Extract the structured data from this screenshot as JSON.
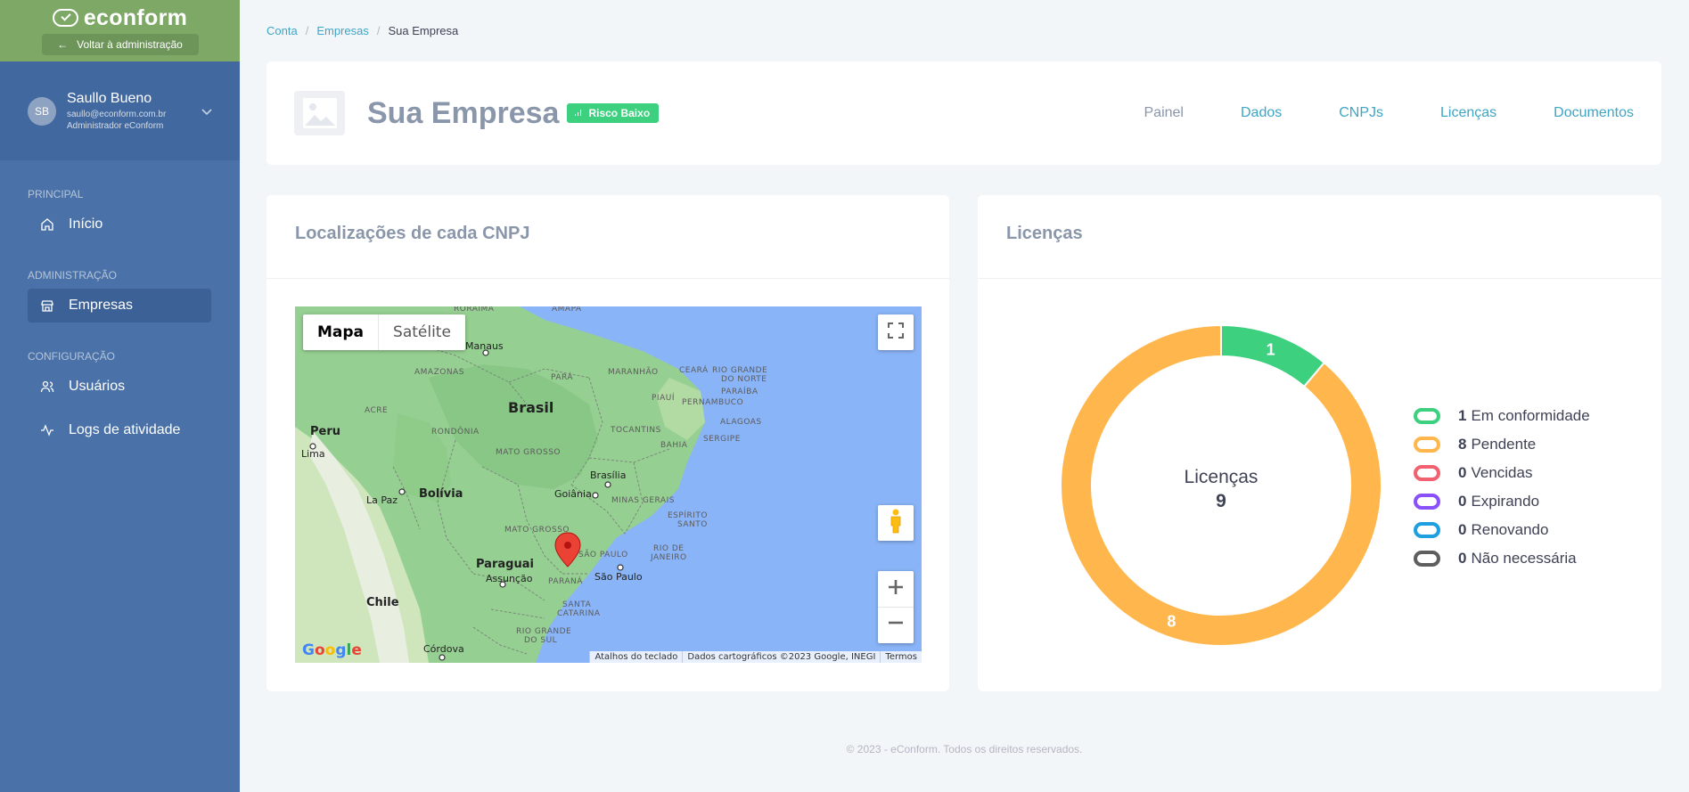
{
  "brand": {
    "name": "econform",
    "back_label": "Voltar à administração"
  },
  "user": {
    "initials": "SB",
    "name": "Saullo Bueno",
    "email": "saullo@econform.com.br",
    "role": "Administrador eConform"
  },
  "nav": {
    "sections": [
      {
        "title": "PRINCIPAL",
        "items": [
          {
            "label": "Início",
            "icon": "home-icon"
          }
        ]
      },
      {
        "title": "ADMINISTRAÇÃO",
        "items": [
          {
            "label": "Empresas",
            "icon": "store-icon",
            "active": true
          }
        ]
      },
      {
        "title": "CONFIGURAÇÃO",
        "items": [
          {
            "label": "Usuários",
            "icon": "users-icon"
          },
          {
            "label": "Logs de atividade",
            "icon": "activity-icon"
          }
        ]
      }
    ]
  },
  "breadcrumb": [
    "Conta",
    "Empresas",
    "Sua Empresa"
  ],
  "company": {
    "name": "Sua Empresa",
    "risk": "Risco Baixo"
  },
  "tabs": [
    "Painel",
    "Dados",
    "CNPJs",
    "Licenças",
    "Documentos"
  ],
  "map_card": {
    "title": "Localizações de cada CNPJ",
    "map_type": {
      "map": "Mapa",
      "satellite": "Satélite"
    },
    "labels": {
      "amapa": "AMAPÁ",
      "roraima": "RORAIMA",
      "manaus": "Manaus",
      "amazonas": "AMAZONAS",
      "para": "PARÁ",
      "maranhao": "MARANHÃO",
      "ceara": "CEARÁ",
      "rio_grande_do_norte_1": "RIO GRANDE",
      "rio_grande_do_norte_2": "DO NORTE",
      "paraiba": "PARAÍBA",
      "piaui": "PIAUÍ",
      "pernambuco": "PERNAMBUCO",
      "alagoas": "ALAGOAS",
      "sergipe": "SERGIPE",
      "acre": "ACRE",
      "brasil": "Brasil",
      "rondonia": "RONDÔNIA",
      "tocantins": "TOCANTINS",
      "bahia": "BAHIA",
      "peru": "Peru",
      "lima": "Lima",
      "mato_grosso": "MATO GROSSO",
      "brasilia": "Brasília",
      "la_paz": "La Paz",
      "bolivia": "Bolívia",
      "goiania": "Goiânia",
      "minas_gerais": "MINAS GERAIS",
      "espirito_santo_1": "ESPÍRITO",
      "espirito_santo_2": "SANTO",
      "mato_grosso_sul": "MATO GROSSO",
      "sao_paulo_state": "SÃO PAULO",
      "rio_de_janeiro_1": "RIO DE",
      "rio_de_janeiro_2": "JANEIRO",
      "paraguai": "Paraguai",
      "assuncao": "Assunção",
      "parana": "PARANÁ",
      "sao_paulo": "São Paulo",
      "chile": "Chile",
      "santa_catarina_1": "SANTA",
      "santa_catarina_2": "CATARINA",
      "rio_grande_do_sul_1": "RIO GRANDE",
      "rio_grande_do_sul_2": "DO SUL",
      "cordova": "Córdova"
    },
    "google": "Google",
    "attribution": [
      "Atalhos do teclado",
      "Dados cartográficos ©2023 Google, INEGI",
      "Termos"
    ],
    "colors": {
      "water": "#8ab4f8",
      "land": "#96cf92",
      "dry_land": "#cfe6bd",
      "andes": "#e8eee0",
      "border": "#7a8a7a",
      "pin": "#ea4335"
    }
  },
  "licenses_card": {
    "title": "Licenças",
    "center_label": "Licenças",
    "center_total": "9"
  },
  "chart_data": {
    "type": "pie",
    "donut": true,
    "title": "",
    "center_label": "Licenças",
    "center_value": 9,
    "legend_position": "right",
    "series": [
      {
        "name": "Em conformidade",
        "value": 1,
        "color": "#3dd07f"
      },
      {
        "name": "Pendente",
        "value": 8,
        "color": "#ffb74d"
      },
      {
        "name": "Vencidas",
        "value": 0,
        "color": "#f1616f"
      },
      {
        "name": "Expirando",
        "value": 0,
        "color": "#8950fc"
      },
      {
        "name": "Renovando",
        "value": 0,
        "color": "#1e9fe0"
      },
      {
        "name": "Não necessária",
        "value": 0,
        "color": "#5e5e5e"
      }
    ]
  },
  "footer": "© 2023 - eConform. Todos os direitos reservados."
}
